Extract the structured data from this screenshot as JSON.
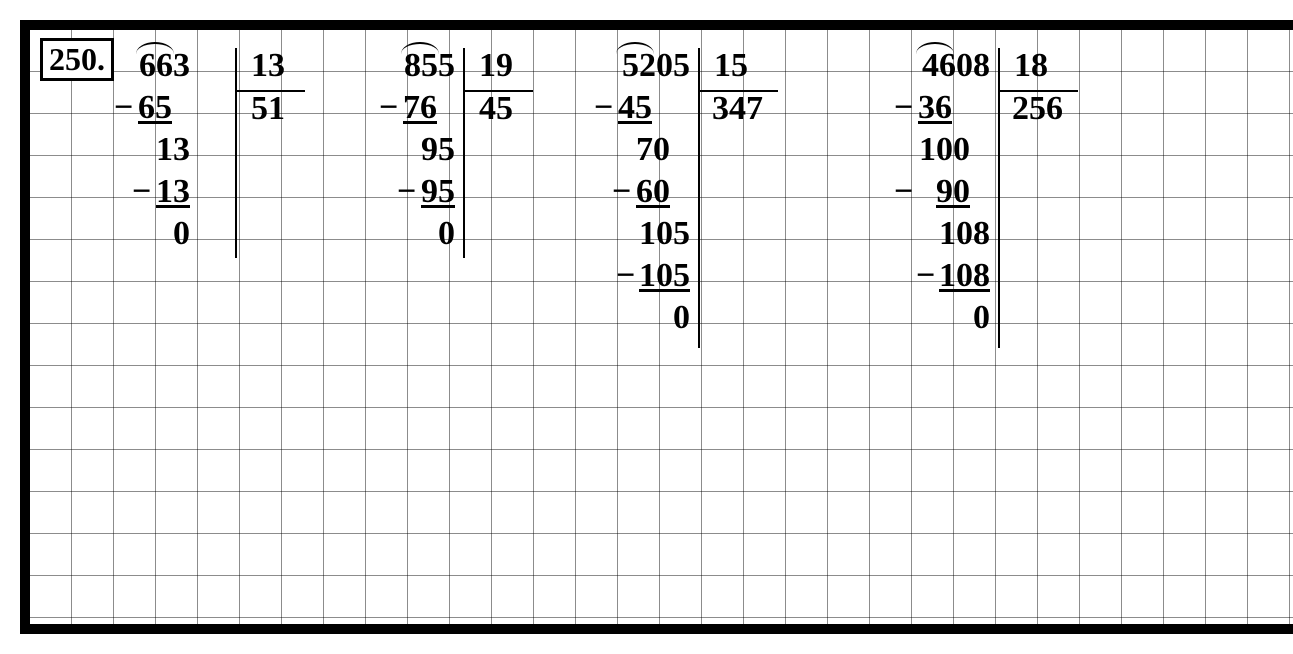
{
  "exercise_number": "250.",
  "problems": [
    {
      "dividend": "663",
      "divisor": "13",
      "quotient": "51",
      "steps": [
        "65",
        "13",
        "13",
        "0"
      ],
      "arc_span": 2
    },
    {
      "dividend": "855",
      "divisor": "19",
      "quotient": "45",
      "steps": [
        "76",
        "95",
        "95",
        "0"
      ],
      "arc_span": 2
    },
    {
      "dividend": "5205",
      "divisor": "15",
      "quotient": "347",
      "steps": [
        "45",
        "70",
        "60",
        "105",
        "105",
        "0"
      ],
      "arc_span": 2
    },
    {
      "dividend": "4608",
      "divisor": "18",
      "quotient": "256",
      "steps": [
        "36",
        "100",
        "90",
        "108",
        "108",
        "0"
      ],
      "arc_span": 2
    }
  ]
}
